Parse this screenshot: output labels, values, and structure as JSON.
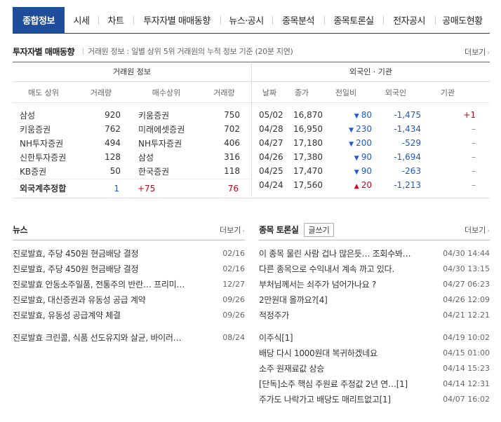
{
  "tabs": [
    {
      "label": "종합정보",
      "active": true
    },
    {
      "label": "시세"
    },
    {
      "label": "차트"
    },
    {
      "label": "투자자별 매매동향"
    },
    {
      "label": "뉴스·공시"
    },
    {
      "label": "종목분석"
    },
    {
      "label": "종목토론실"
    },
    {
      "label": "전자공시"
    },
    {
      "label": "공매도현황"
    }
  ],
  "investor": {
    "title": "투자자별 매매동향",
    "desc": "거래원 정보 : 일별 상위 5위 거래원의 누적 정보 기준 (20분 지연)",
    "more": "더보기",
    "broker": {
      "title": "거래원 정보",
      "headers": [
        "매도 상위",
        "거래량",
        "매수상위",
        "거래량"
      ],
      "rows": [
        {
          "sell": "삼성",
          "sell_vol": "920",
          "buy": "키움증권",
          "buy_vol": "750"
        },
        {
          "sell": "키움증권",
          "sell_vol": "762",
          "buy": "미래에셋증권",
          "buy_vol": "702"
        },
        {
          "sell": "NH투자증권",
          "sell_vol": "494",
          "buy": "NH투자증권",
          "buy_vol": "406"
        },
        {
          "sell": "신한투자증권",
          "sell_vol": "128",
          "buy": "삼성",
          "buy_vol": "316"
        },
        {
          "sell": "KB증권",
          "sell_vol": "50",
          "buy": "한국증권",
          "buy_vol": "118"
        }
      ],
      "foreign": {
        "label": "외국계추정합",
        "sell_vol": "1",
        "net": "+75",
        "buy_vol": "76"
      }
    },
    "foreign_inst": {
      "title": "외국인 · 기관",
      "headers": [
        "날짜",
        "종가",
        "전일비",
        "외국인",
        "기관"
      ],
      "rows": [
        {
          "date": "05/02",
          "close": "16,870",
          "dir": "down",
          "change": "80",
          "foreign": "-1,475",
          "inst": "+1"
        },
        {
          "date": "04/28",
          "close": "16,950",
          "dir": "down",
          "change": "230",
          "foreign": "-1,434",
          "inst": "–"
        },
        {
          "date": "04/27",
          "close": "17,180",
          "dir": "down",
          "change": "200",
          "foreign": "-529",
          "inst": "–"
        },
        {
          "date": "04/26",
          "close": "17,380",
          "dir": "down",
          "change": "90",
          "foreign": "-1,694",
          "inst": "–"
        },
        {
          "date": "04/25",
          "close": "17,470",
          "dir": "down",
          "change": "90",
          "foreign": "-263",
          "inst": "–"
        },
        {
          "date": "04/24",
          "close": "17,560",
          "dir": "up",
          "change": "20",
          "foreign": "-1,213",
          "inst": "–"
        }
      ]
    }
  },
  "news": {
    "title": "뉴스",
    "more": "더보기",
    "items": [
      {
        "title": "진로발효, 주당 450원 현금배당 결정",
        "date": "02/16"
      },
      {
        "title": "진로발효, 주당 450원 현금배당 결정",
        "date": "02/16"
      },
      {
        "title": "진로발효 안동소주일품, 전통주의 반란… 프리미…",
        "date": "12/27"
      },
      {
        "title": "진로발효, 대신증권과 유동성 공급 계약",
        "date": "09/26"
      },
      {
        "title": "진로발효, 유동성 공급계약 체결",
        "date": "09/26"
      }
    ],
    "items2": [
      {
        "title": "진로발효 크린콜, 식품 선도유지와 살균, 바이러…",
        "date": "08/24"
      }
    ]
  },
  "board": {
    "title": "종목 토론실",
    "write": "글쓰기",
    "more": "더보기",
    "items": [
      {
        "title": "이 종목 물린 사람 겁나 많은듯… 조회수봐…",
        "date": "04/30 14:44"
      },
      {
        "title": "다른 종목으로 수익내서 계속 까고 있다.",
        "date": "04/30 13:15"
      },
      {
        "title": "부처님께서는 쇠주가 넘어가나요 ?",
        "date": "04/27 06:23"
      },
      {
        "title": "2만원대 올까요?[4]",
        "date": "04/26 12:09"
      },
      {
        "title": "적정주가",
        "date": "04/21 12:21"
      }
    ],
    "items2": [
      {
        "title": "이주식[1]",
        "date": "04/19 10:02"
      },
      {
        "title": "배당 다시 1000원대 복귀하겠네요",
        "date": "04/15 01:00"
      },
      {
        "title": "소주 원재료값 상승",
        "date": "04/14 15:23"
      },
      {
        "title": "[단독]소주 핵심 주원료 주정값 2년 연…[1]",
        "date": "04/14 12:31"
      },
      {
        "title": "주가도 나락가고 배당도 매리트없고[1]",
        "date": "04/07 16:02"
      }
    ]
  },
  "colors": {
    "tab_active": "#1e4d9a",
    "up": "#d0021b",
    "down": "#1f5bc6"
  }
}
